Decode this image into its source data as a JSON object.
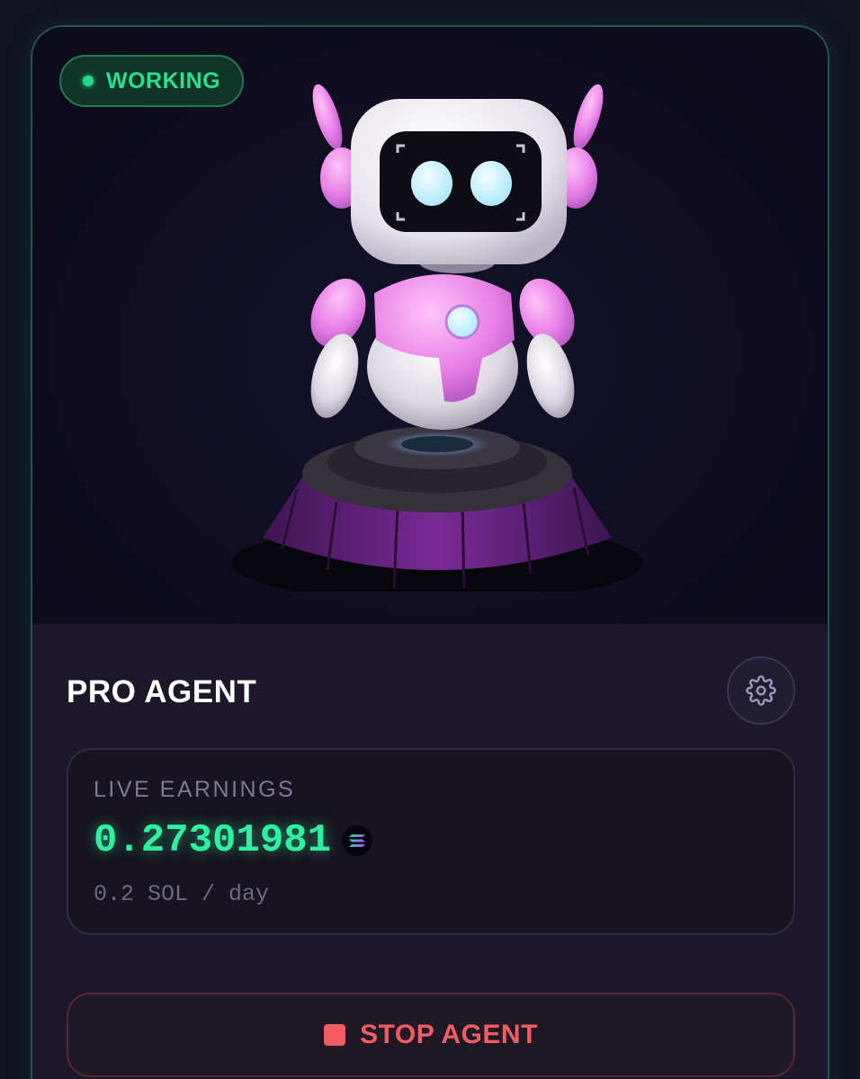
{
  "status": {
    "label": "WORKING",
    "color": "#27e092"
  },
  "hero": {
    "image": "robot-on-pedestal-illustration"
  },
  "agent": {
    "title": "PRO AGENT",
    "settings_icon": "gear-icon"
  },
  "earnings": {
    "label": "LIVE EARNINGS",
    "value": "0.27301981",
    "currency_icon": "solana-icon",
    "rate": "0.2 SOL / day",
    "value_color": "#2ff0a0"
  },
  "actions": {
    "stop_label": "STOP AGENT",
    "stop_icon": "stop-square-icon",
    "stop_color": "#f25c62"
  }
}
